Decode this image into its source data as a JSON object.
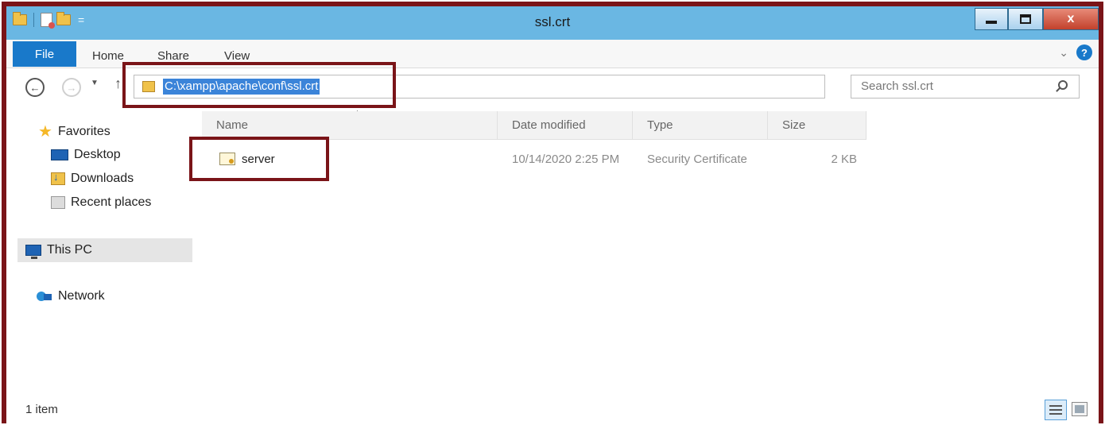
{
  "window": {
    "title": "ssl.crt",
    "close_glyph": "x"
  },
  "ribbon": {
    "tabs": [
      "File",
      "Home",
      "Share",
      "View"
    ],
    "help_glyph": "?"
  },
  "address": {
    "path": "C:\\xampp\\apache\\conf\\ssl.crt",
    "search_placeholder": "Search ssl.crt"
  },
  "nav_pane": {
    "favorites": "Favorites",
    "items": [
      "Desktop",
      "Downloads",
      "Recent places"
    ],
    "this_pc": "This PC",
    "network": "Network"
  },
  "columns": [
    "Name",
    "Date modified",
    "Type",
    "Size"
  ],
  "files": [
    {
      "name": "server",
      "date": "10/14/2020 2:25 PM",
      "type": "Security Certificate",
      "size": "2 KB"
    }
  ],
  "status": {
    "count": "1 item"
  },
  "icons": {
    "favorites": "star-icon",
    "desktop": "desktop-icon",
    "downloads": "downloads-icon",
    "recent": "recent-places-icon",
    "this_pc": "computer-icon",
    "network": "network-icon",
    "file": "certificate-icon"
  },
  "colors": {
    "titlebar": "#6ab7e3",
    "file_tab": "#1979ca",
    "selection": "#3b84d9",
    "annotation": "#7a1418"
  }
}
